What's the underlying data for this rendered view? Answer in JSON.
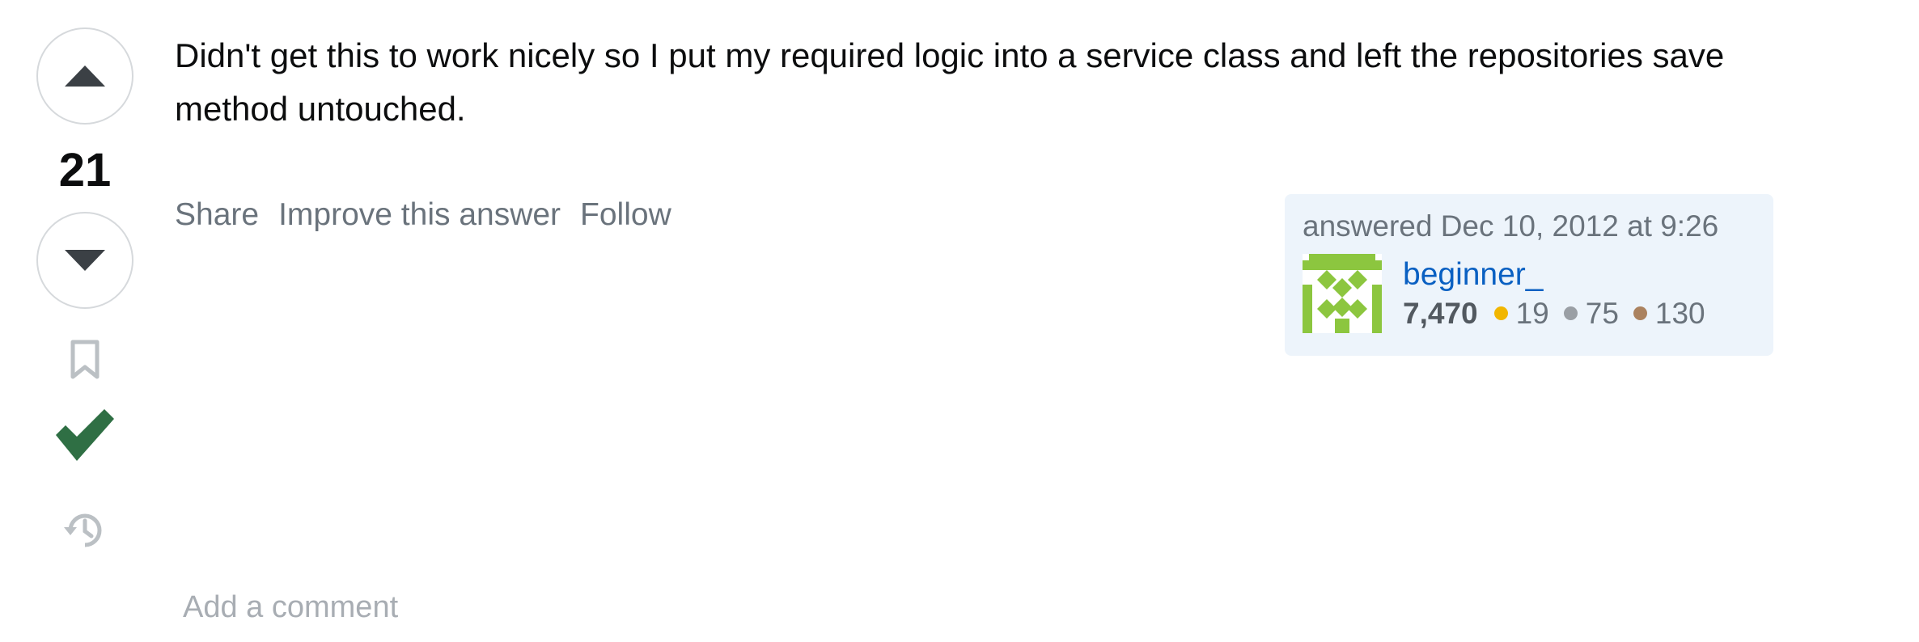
{
  "votes": {
    "count": "21",
    "upvote_icon": "arrow-up-icon",
    "downvote_icon": "arrow-down-icon",
    "bookmark_icon": "bookmark-icon",
    "accepted_icon": "checkmark-icon",
    "history_icon": "history-icon"
  },
  "post": {
    "body": "Didn't get this to work nicely so I put my required logic into a service class and left the repositories save method untouched."
  },
  "menu": {
    "share": "Share",
    "improve": "Improve this answer",
    "follow": "Follow"
  },
  "user_card": {
    "action": "answered Dec 10, 2012 at 9:26",
    "name": "beginner_",
    "reputation": "7,470",
    "gold": "19",
    "silver": "75",
    "bronze": "130",
    "gold_color": "#f1b600",
    "silver_color": "#9a9fa5",
    "bronze_color": "#ab825f",
    "avatar_color": "#8cc63f"
  },
  "comments": {
    "add_label": "Add a comment"
  },
  "colors": {
    "accepted": "#2f6f44",
    "card_bg": "#edf4fb",
    "link": "#0a60c2"
  }
}
